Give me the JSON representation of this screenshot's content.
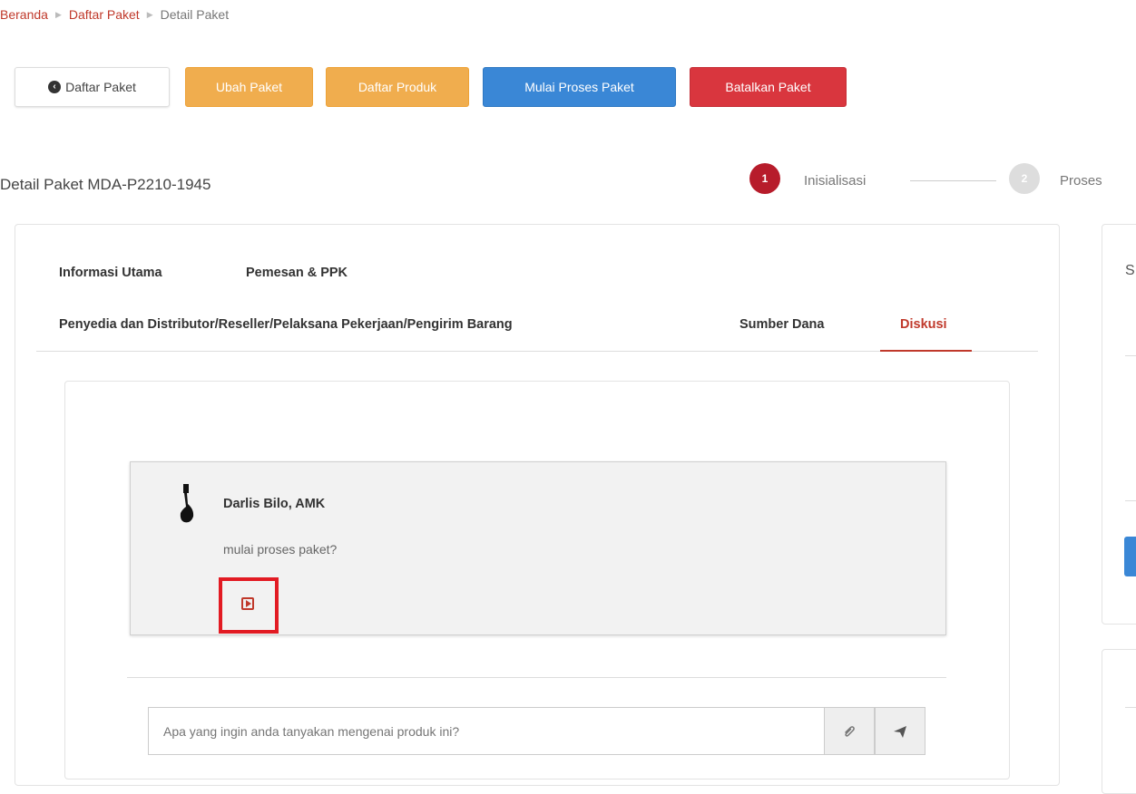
{
  "breadcrumb": {
    "home": "Beranda",
    "list": "Daftar Paket",
    "current": "Detail Paket"
  },
  "toolbar": {
    "back": "Daftar Paket",
    "edit": "Ubah Paket",
    "products": "Daftar Produk",
    "start": "Mulai Proses Paket",
    "cancel": "Batalkan Paket"
  },
  "header": {
    "title": "Detail Paket MDA-P2210-1945"
  },
  "steps": [
    {
      "number": "1",
      "label": "Inisialisasi"
    },
    {
      "number": "2",
      "label": "Proses"
    }
  ],
  "tabs": {
    "info": "Informasi Utama",
    "buyer": "Pemesan & PPK",
    "provider": "Penyedia dan Distributor/Reseller/Pelaksana Pekerjaan/Pengirim Barang",
    "fund": "Sumber Dana",
    "discussion": "Diskusi"
  },
  "discussion": {
    "author": "Darlis Bilo, AMK",
    "message": "mulai proses paket?",
    "input_placeholder": "Apa yang ingin anda tanyakan mengenai produk ini?"
  },
  "side_panel": {
    "heading_initial": "S"
  },
  "colors": {
    "accent": "#c0392b",
    "warning": "#f0ad4e",
    "primary": "#3a87d6",
    "danger": "#d9363e"
  }
}
